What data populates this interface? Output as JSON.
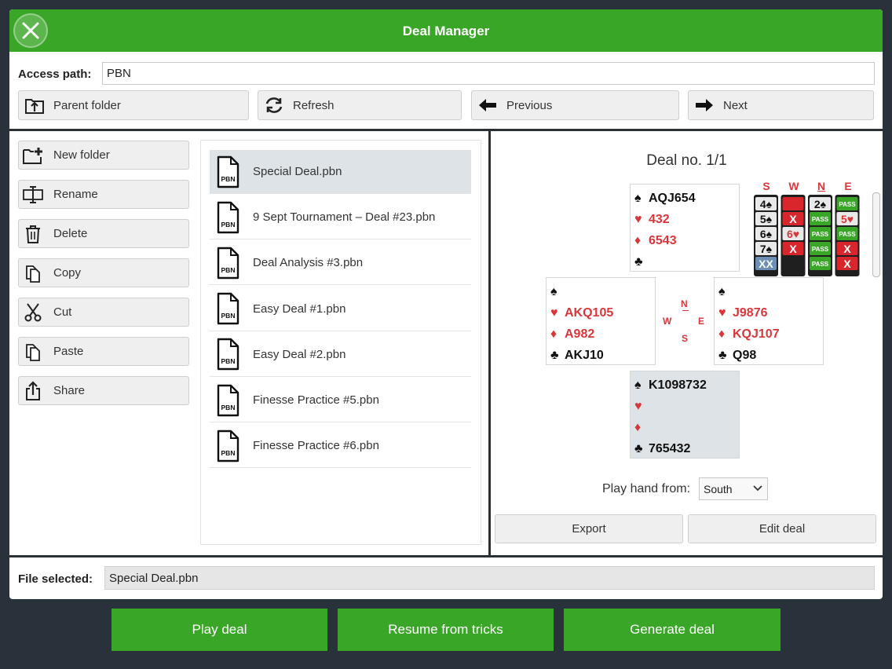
{
  "window": {
    "title": "Deal Manager"
  },
  "access": {
    "label": "Access path:",
    "value": "PBN"
  },
  "nav": {
    "parent_folder": "Parent folder",
    "refresh": "Refresh",
    "previous": "Previous",
    "next": "Next"
  },
  "sidebar": {
    "items": [
      {
        "label": "New folder",
        "icon": "new-folder-icon"
      },
      {
        "label": "Rename",
        "icon": "rename-icon"
      },
      {
        "label": "Delete",
        "icon": "trash-icon"
      },
      {
        "label": "Copy",
        "icon": "copy-icon"
      },
      {
        "label": "Cut",
        "icon": "scissors-icon"
      },
      {
        "label": "Paste",
        "icon": "paste-icon"
      },
      {
        "label": "Share",
        "icon": "share-icon"
      }
    ]
  },
  "files": {
    "selected_index": 0,
    "icon_label": "PBN",
    "items": [
      "Special Deal.pbn",
      "9 Sept Tournament – Deal #23.pbn",
      "Deal Analysis #3.pbn",
      "Easy Deal #1.pbn",
      "Easy Deal #2.pbn",
      "Finesse Practice #5.pbn",
      "Finesse Practice #6.pbn"
    ]
  },
  "deal": {
    "title": "Deal no. 1/1",
    "north": {
      "spades": "AQJ654",
      "hearts": "432",
      "diamonds": "6543",
      "clubs": ""
    },
    "west": {
      "spades": "",
      "hearts": "AKQ105",
      "diamonds": "A982",
      "clubs": "AKJ10"
    },
    "east": {
      "spades": "",
      "hearts": "J9876",
      "diamonds": "KQJ107",
      "clubs": "Q98"
    },
    "south": {
      "spades": "K1098732",
      "hearts": "",
      "diamonds": "",
      "clubs": "765432"
    },
    "compass": {
      "n": "N",
      "w": "W",
      "e": "E",
      "s": "S"
    },
    "suit_symbols": {
      "spades": "♠",
      "hearts": "♥",
      "diamonds": "♦",
      "clubs": "♣"
    }
  },
  "bidding": {
    "headers": [
      "S",
      "W",
      "N",
      "E"
    ],
    "columns": [
      [
        "4♠",
        "5♠",
        "6♠",
        "7♠",
        "XX"
      ],
      [
        "",
        "X",
        "6♥",
        "X",
        ""
      ],
      [
        "2♠",
        "PASS",
        "PASS",
        "PASS",
        "PASS"
      ],
      [
        "PASS",
        "5♥",
        "PASS",
        "X",
        "X"
      ]
    ]
  },
  "play": {
    "label": "Play hand from:",
    "selected": "South"
  },
  "deal_actions": {
    "export": "Export",
    "edit": "Edit deal"
  },
  "selection": {
    "label": "File selected:",
    "value": "Special Deal.pbn"
  },
  "footer": {
    "play_deal": "Play deal",
    "resume": "Resume from tricks",
    "generate": "Generate deal"
  },
  "colors": {
    "accent_green": "#3aa627",
    "background_dark": "#29323a",
    "suit_red": "#d9363a"
  }
}
